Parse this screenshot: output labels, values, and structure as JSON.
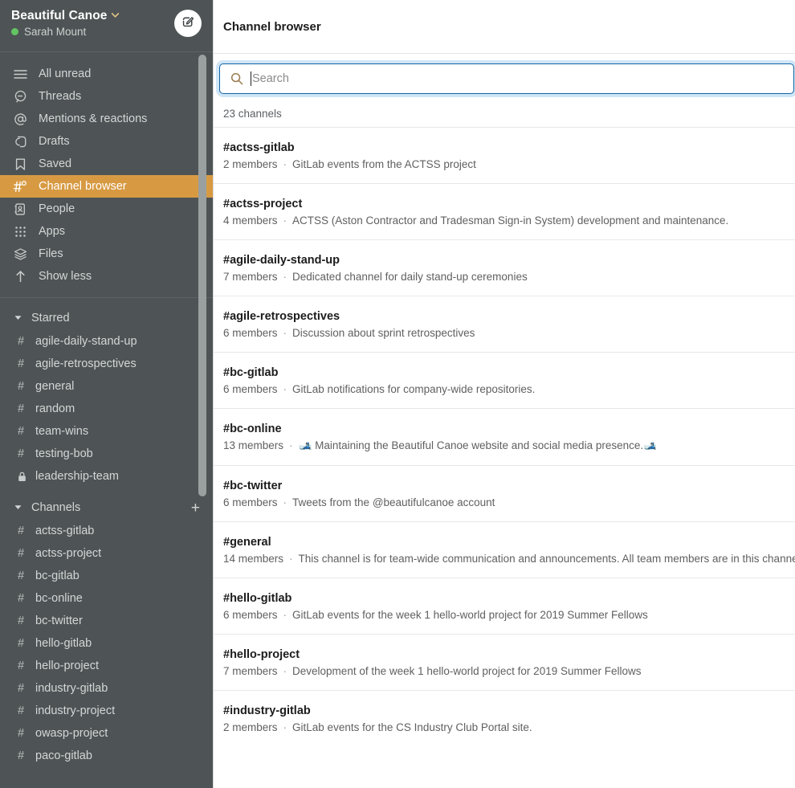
{
  "workspace": {
    "name": "Beautiful Canoe",
    "chevron": "⌄",
    "user": "Sarah Mount",
    "compose_icon": "compose-icon",
    "status_color": "#62c462"
  },
  "sidebar": {
    "nav": [
      {
        "label": "All unread",
        "icon": "hamburger-icon",
        "active": false
      },
      {
        "label": "Threads",
        "icon": "threads-icon",
        "active": false
      },
      {
        "label": "Mentions & reactions",
        "icon": "at-icon",
        "active": false
      },
      {
        "label": "Drafts",
        "icon": "drafts-icon",
        "active": false
      },
      {
        "label": "Saved",
        "icon": "bookmark-icon",
        "active": false
      },
      {
        "label": "Channel browser",
        "icon": "channel-browser-icon",
        "active": true
      },
      {
        "label": "People",
        "icon": "people-icon",
        "active": false
      },
      {
        "label": "Apps",
        "icon": "apps-grid-icon",
        "active": false
      },
      {
        "label": "Files",
        "icon": "files-layers-icon",
        "active": false
      },
      {
        "label": "Show less",
        "icon": "arrow-up-icon",
        "active": false
      }
    ],
    "starred": {
      "label": "Starred",
      "items": [
        {
          "name": "agile-daily-stand-up",
          "type": "public"
        },
        {
          "name": "agile-retrospectives",
          "type": "public"
        },
        {
          "name": "general",
          "type": "public"
        },
        {
          "name": "random",
          "type": "public"
        },
        {
          "name": "team-wins",
          "type": "public"
        },
        {
          "name": "testing-bob",
          "type": "public"
        },
        {
          "name": "leadership-team",
          "type": "private"
        }
      ]
    },
    "channels": {
      "label": "Channels",
      "add_label": "+",
      "items": [
        {
          "name": "actss-gitlab",
          "type": "public"
        },
        {
          "name": "actss-project",
          "type": "public"
        },
        {
          "name": "bc-gitlab",
          "type": "public"
        },
        {
          "name": "bc-online",
          "type": "public"
        },
        {
          "name": "bc-twitter",
          "type": "public"
        },
        {
          "name": "hello-gitlab",
          "type": "public"
        },
        {
          "name": "hello-project",
          "type": "public"
        },
        {
          "name": "industry-gitlab",
          "type": "public"
        },
        {
          "name": "industry-project",
          "type": "public"
        },
        {
          "name": "owasp-project",
          "type": "public"
        },
        {
          "name": "paco-gitlab",
          "type": "public"
        }
      ]
    },
    "accent_active": "#d79a43",
    "background": "#4e5455"
  },
  "main": {
    "title": "Channel browser",
    "search": {
      "placeholder": "Search",
      "value": "",
      "icon": "search-icon",
      "focused": true,
      "focus_color": "#1264a3"
    },
    "count_label": "23 channels",
    "channels": [
      {
        "name": "#actss-gitlab",
        "members": "2 members",
        "separator": "·",
        "description": "GitLab events from the ACTSS project",
        "emoji_before": "",
        "emoji_after": ""
      },
      {
        "name": "#actss-project",
        "members": "4 members",
        "separator": "·",
        "description": "ACTSS (Aston Contractor and Tradesman Sign-in System) development and maintenance.",
        "emoji_before": "",
        "emoji_after": ""
      },
      {
        "name": "#agile-daily-stand-up",
        "members": "7 members",
        "separator": "·",
        "description": "Dedicated channel for daily stand-up ceremonies",
        "emoji_before": "",
        "emoji_after": ""
      },
      {
        "name": "#agile-retrospectives",
        "members": "6 members",
        "separator": "·",
        "description": "Discussion about sprint retrospectives",
        "emoji_before": "",
        "emoji_after": ""
      },
      {
        "name": "#bc-gitlab",
        "members": "6 members",
        "separator": "·",
        "description": "GitLab notifications for company-wide repositories.",
        "emoji_before": "",
        "emoji_after": ""
      },
      {
        "name": "#bc-online",
        "members": "13 members",
        "separator": "·",
        "description": "Maintaining the Beautiful Canoe website and social media presence.",
        "emoji_before": "🎿",
        "emoji_after": "🎿"
      },
      {
        "name": "#bc-twitter",
        "members": "6 members",
        "separator": "·",
        "description": "Tweets from the @beautifulcanoe account",
        "emoji_before": "",
        "emoji_after": ""
      },
      {
        "name": "#general",
        "members": "14 members",
        "separator": "·",
        "description": "This channel is for team-wide communication and announcements. All team members are in this channel.",
        "emoji_before": "",
        "emoji_after": ""
      },
      {
        "name": "#hello-gitlab",
        "members": "6 members",
        "separator": "·",
        "description": "GitLab events for the week 1 hello-world project for 2019 Summer Fellows",
        "emoji_before": "",
        "emoji_after": ""
      },
      {
        "name": "#hello-project",
        "members": "7 members",
        "separator": "·",
        "description": "Development of the week 1 hello-world project for 2019 Summer Fellows",
        "emoji_before": "",
        "emoji_after": ""
      },
      {
        "name": "#industry-gitlab",
        "members": "2 members",
        "separator": "·",
        "description": "GitLab events for the CS Industry Club Portal site.",
        "emoji_before": "",
        "emoji_after": ""
      }
    ]
  }
}
